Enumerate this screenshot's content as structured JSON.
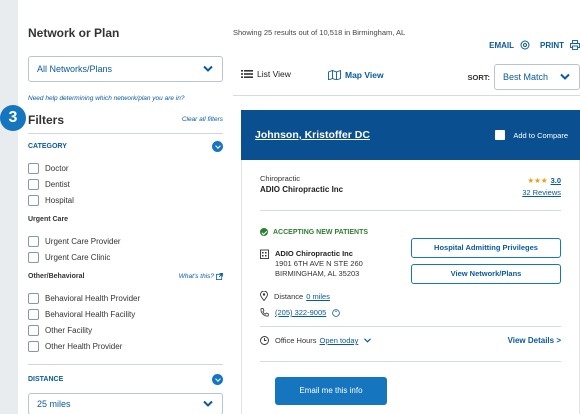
{
  "left": {
    "network_title": "Network or Plan",
    "network_select": "All Networks/Plans",
    "help_link": "Need help determining which network/plan you are in?",
    "step_badge": "3",
    "filters_title": "Filters",
    "clear_all": "Clear all filters",
    "category": {
      "title": "CATEGORY",
      "options": [
        "Doctor",
        "Dentist",
        "Hospital"
      ]
    },
    "urgent_care": {
      "title": "Urgent Care",
      "options": [
        "Urgent Care Provider",
        "Urgent Care Clinic"
      ]
    },
    "other_behavioral": {
      "title": "Other/Behavioral",
      "whats_this": "What's this?",
      "options": [
        "Behavioral Health Provider",
        "Behavioral Health Facility",
        "Other Facility",
        "Other Health Provider"
      ]
    },
    "distance": {
      "title": "DISTANCE",
      "value": "25 miles"
    }
  },
  "right": {
    "showing": "Showing 25 results out of 10,518 in Birmingham, AL",
    "email_link": "EMAIL",
    "print_link": "PRINT",
    "tabs": {
      "list": "List View",
      "map": "Map View"
    },
    "sort_label": "SORT:",
    "sort_value": "Best Match",
    "card": {
      "name": "Johnson, Kristoffer DC",
      "compare": "Add to Compare",
      "specialty": "Chiropractic",
      "practice": "ADIO Chiropractic Inc",
      "stars": "★★★",
      "rating": "3.0",
      "reviews": "32 Reviews",
      "accepting": "ACCEPTING NEW PATIENTS",
      "addr_name": "ADIO Chiropractic Inc",
      "addr_line1": "1901 6TH AVE N STE 260",
      "addr_line2": "BIRMINGHAM, AL 35203",
      "distance_label": "Distance",
      "distance_value": "0 miles",
      "phone": "(205) 322-9005",
      "office_hours_label": "Office Hours",
      "office_hours_value": "Open today",
      "btn_hospital": "Hospital Admitting Privileges",
      "btn_network": "View Network/Plans",
      "view_details": "View Details >",
      "email_btn": "Email me this info"
    }
  },
  "colors": {
    "brand": "#0a4f8f",
    "accent": "#1675bf",
    "link": "#0a5aa0",
    "success": "#2f7d32",
    "star": "#e3a21a"
  }
}
